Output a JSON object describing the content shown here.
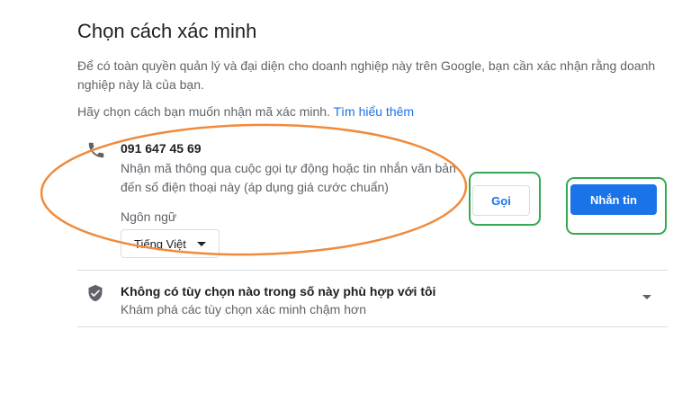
{
  "header": {
    "title": "Chọn cách xác minh",
    "description": "Để có toàn quyền quản lý và đại diện cho doanh nghiệp này trên Google, bạn cần xác nhận rằng doanh nghiệp này là của bạn.",
    "choose_prefix": "Hãy chọn cách bạn muốn nhận mã xác minh. ",
    "learn_more": "Tìm hiểu thêm"
  },
  "phone_option": {
    "icon": "phone-icon",
    "number": "091 647 45 69",
    "description": "Nhận mã thông qua cuộc gọi tự động hoặc tin nhắn văn bản đến số điện thoại này (áp dụng giá cước chuẩn)",
    "language_label": "Ngôn ngữ",
    "language_value": "Tiếng Việt",
    "call_button": "Gọi",
    "text_button": "Nhắn tin"
  },
  "other_option": {
    "icon": "shield-icon",
    "title": "Không có tùy chọn nào trong số này phù hợp với tôi",
    "subtitle": "Khám phá các tùy chọn xác minh chậm hơn"
  },
  "colors": {
    "accent": "#1a73e8",
    "annotation_orange": "#f08a3c",
    "annotation_green": "#34a853"
  }
}
